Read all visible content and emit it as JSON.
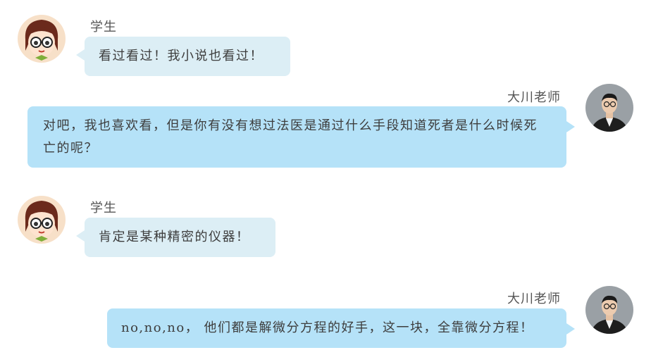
{
  "messages": [
    {
      "sender": "学生",
      "role": "student",
      "text": "看过看过！我小说也看过！"
    },
    {
      "sender": "大川老师",
      "role": "teacher",
      "text": "对吧，我也喜欢看，但是你有没有想过法医是通过什么手段知道死者是什么时候死亡的呢？"
    },
    {
      "sender": "学生",
      "role": "student",
      "text": "肯定是某种精密的仪器！"
    },
    {
      "sender": "大川老师",
      "role": "teacher",
      "text": "no,no,no， 他们都是解微分方程的好手，这一块，全靠微分方程！"
    }
  ],
  "colors": {
    "student_bubble": "#dceef5",
    "teacher_bubble": "#b5e2f8"
  },
  "icons": {
    "student_avatar": "cartoon-girl-with-glasses-avatar",
    "teacher_avatar": "teacher-photo-avatar"
  }
}
